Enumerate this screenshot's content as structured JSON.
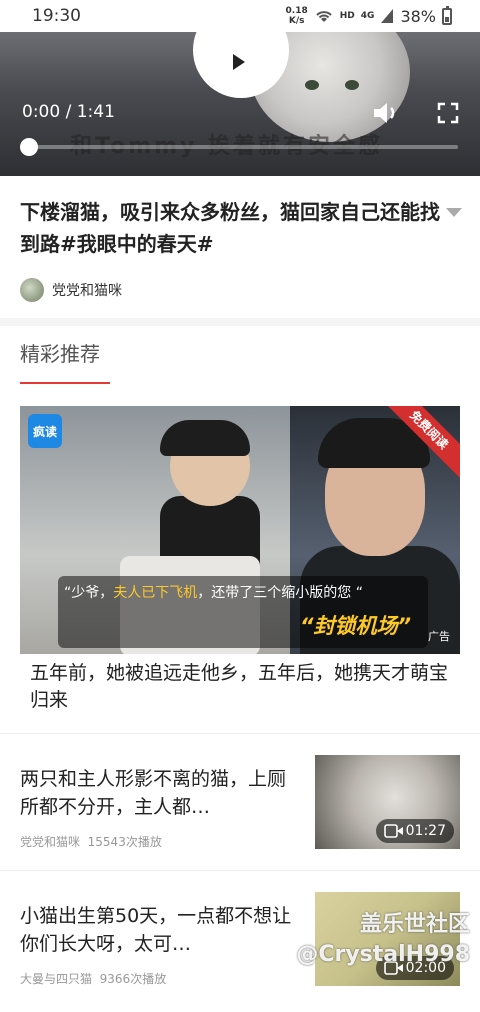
{
  "status_bar": {
    "time": "19:30",
    "speed_value": "0.18",
    "speed_unit": "K/s",
    "network_hd": "HD",
    "network_4g": "4G",
    "battery": "38%"
  },
  "video": {
    "subtitle": "和Tommy 挨着就有安全感",
    "time_readout": "0:00 / 1:41",
    "progress_fraction": 0.0
  },
  "post": {
    "title": "下楼溜猫，吸引来众多粉丝，猫回家自己还能找到路#我眼中的春天#",
    "author": "党党和猫咪"
  },
  "section": {
    "title": "精彩推荐"
  },
  "ad": {
    "logo": "疯读",
    "corner": "免费阅读",
    "caption_open": "“少爷，",
    "caption_highlight": "夫人已下飞机",
    "caption_rest": "，还带了三个缩小版的您 “",
    "caption_big": "“封锁机场”",
    "tag": "广告",
    "title": "五年前，她被追远走他乡，五年后，她携天才萌宝归来"
  },
  "feed": [
    {
      "title": "两只和主人形影不离的猫，上厕所都不分开，主人都…",
      "author": "党党和猫咪",
      "plays": "15543次播放",
      "duration": "01:27",
      "thumb_color": "#b9b5ae"
    },
    {
      "title": "小猫出生第50天，一点都不想让你们长大呀，太可…",
      "author": "大曼与四只猫",
      "plays": "9366次播放",
      "duration": "02:00",
      "thumb_color": "#c6c08a"
    }
  ],
  "watermark": {
    "line1": "盖乐世社区",
    "line2": "@CrystalH998"
  }
}
